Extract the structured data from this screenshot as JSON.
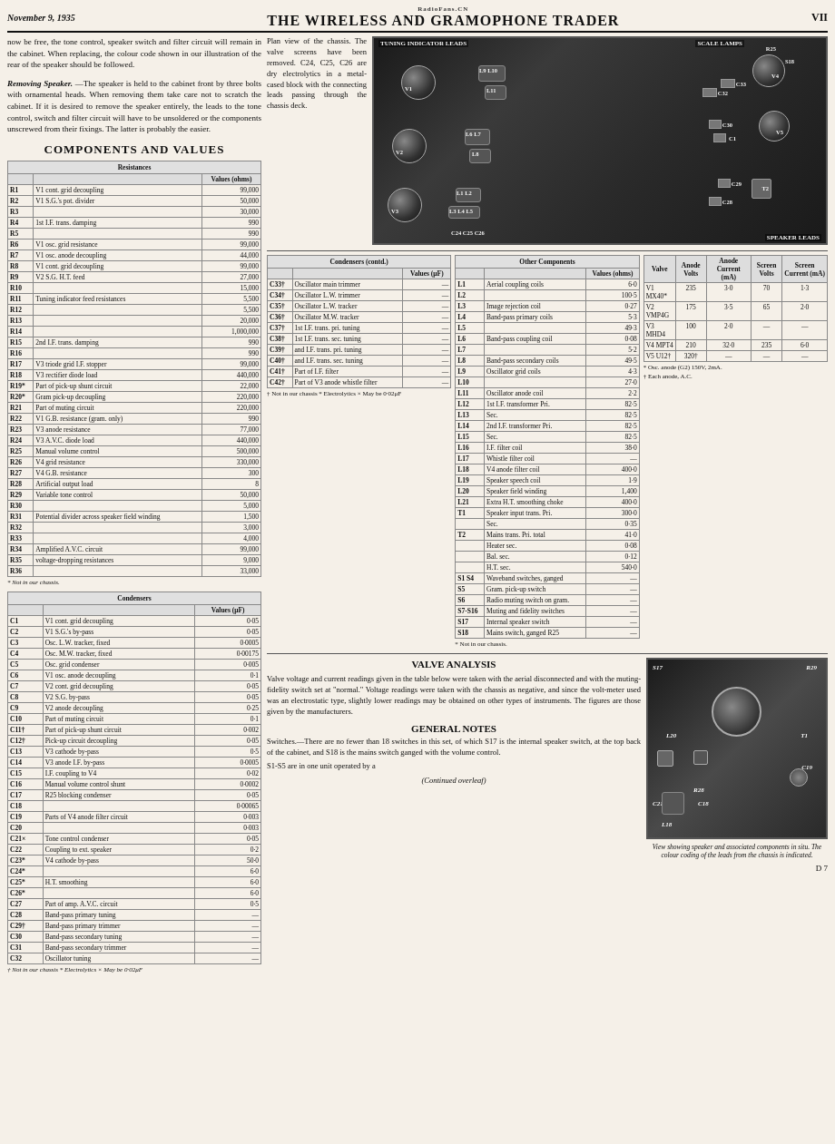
{
  "header": {
    "date": "November 9, 1935",
    "title": "THE WIRELESS AND GRAMOPHONE TRADER",
    "radiofans": "RadioFans.CN",
    "page": "VII"
  },
  "intro": {
    "paragraph1": "now be free, the tone control, speaker switch and filter circuit will remain in the cabinet. When replacing, the colour code shown in our illustration of the rear of the speaker should be followed.",
    "removing_heading": "Removing Speaker.",
    "paragraph2": "—The speaker is held to the cabinet front by three bolts with ornamental heads. When removing them take care not to scratch the cabinet. If it is desired to remove the speaker entirely, the leads to the tone control, switch and filter circuit will have to be unsoldered or the components unscrewed from their fixings. The latter is probably the easier."
  },
  "components_title": "COMPONENTS AND VALUES",
  "chassis_desc": {
    "text1": "Plan view of the chassis. The valve screens have been removed. C24, C25, C26 are dry electrolytics in a metal-cased block with the connecting leads passing through the chassis deck."
  },
  "chassis_labels": {
    "tuning_indicator": "TUNING INDICATOR LEADS",
    "scale_lamps": "SCALE LAMPS",
    "speaker_leads": "SPEAKER LEADS",
    "v1": "V1",
    "v2": "V2",
    "v3": "V3",
    "v4": "V4",
    "v5": "V5",
    "r25": "R25",
    "s18": "S18",
    "c24": "C24",
    "c25": "C25",
    "c26": "C26",
    "c28": "C28",
    "c29": "C29",
    "c30": "C30",
    "c32": "C32",
    "c33": "C33",
    "l9l10": "L9 L10",
    "l11": "L11",
    "l6l7": "L6 L7",
    "l8": "L8",
    "l1l2": "L1 L2",
    "l3l4l5": "L3 L4 L5",
    "t2": "T2"
  },
  "resistances": {
    "title": "Resistances",
    "values_header": "Values (ohms)",
    "rows": [
      {
        "ref": "R1",
        "desc": "V1 cont. grid decoupling",
        "val": "99,000"
      },
      {
        "ref": "R2",
        "desc": "V1 S.G.'s pot. divider",
        "val": "50,000"
      },
      {
        "ref": "R3",
        "desc": "",
        "val": "30,000"
      },
      {
        "ref": "R4",
        "desc": "1st I.F. trans. damping",
        "val": "990"
      },
      {
        "ref": "R5",
        "desc": "",
        "val": "990"
      },
      {
        "ref": "R6",
        "desc": "V1 osc. grid resistance",
        "val": "99,000"
      },
      {
        "ref": "R7",
        "desc": "V1 osc. anode decoupling",
        "val": "44,000"
      },
      {
        "ref": "R8",
        "desc": "V1 cont. grid decoupling",
        "val": "99,000"
      },
      {
        "ref": "R9",
        "desc": "V2 S.G. H.T. feed",
        "val": "27,000"
      },
      {
        "ref": "R10",
        "desc": "",
        "val": "15,000"
      },
      {
        "ref": "R11",
        "desc": "Tuning indicator feed resistances",
        "val": "5,500"
      },
      {
        "ref": "R12",
        "desc": "",
        "val": "5,500"
      },
      {
        "ref": "R13",
        "desc": "",
        "val": "20,000"
      },
      {
        "ref": "R14",
        "desc": "",
        "val": "1,000,000"
      },
      {
        "ref": "R15",
        "desc": "2nd I.F. trans. damping",
        "val": "990"
      },
      {
        "ref": "R16",
        "desc": "",
        "val": "990"
      },
      {
        "ref": "R17",
        "desc": "V3 triode grid I.F. stopper",
        "val": "99,000"
      },
      {
        "ref": "R18",
        "desc": "V3 rectifier diode load",
        "val": "440,000"
      },
      {
        "ref": "R19*",
        "desc": "Part of pick-up shunt circuit",
        "val": "22,000"
      },
      {
        "ref": "R20*",
        "desc": "Gram pick-up decoupling",
        "val": "220,000"
      },
      {
        "ref": "R21",
        "desc": "Part of muting circuit",
        "val": "220,000"
      },
      {
        "ref": "R22",
        "desc": "V1 G.B. resistance (gram. only)",
        "val": "990"
      },
      {
        "ref": "R23",
        "desc": "V3 anode resistance",
        "val": "77,000"
      },
      {
        "ref": "R24",
        "desc": "V3 A.V.C. diode load",
        "val": "440,000"
      },
      {
        "ref": "R25",
        "desc": "Manual volume control",
        "val": "500,000"
      },
      {
        "ref": "R26",
        "desc": "V4 grid resistance",
        "val": "330,000"
      },
      {
        "ref": "R27",
        "desc": "V4 G.B. resistance",
        "val": "300"
      },
      {
        "ref": "R28",
        "desc": "Artificial output load",
        "val": "8"
      },
      {
        "ref": "R29",
        "desc": "Variable tone control",
        "val": "50,000"
      },
      {
        "ref": "R30",
        "desc": "",
        "val": "5,000"
      },
      {
        "ref": "R31",
        "desc": "Potential divider across speaker field winding",
        "val": "1,500"
      },
      {
        "ref": "R32",
        "desc": "",
        "val": "3,000"
      },
      {
        "ref": "R33",
        "desc": "",
        "val": "4,000"
      },
      {
        "ref": "R34",
        "desc": "Amplified A.V.C. circuit",
        "val": "99,000"
      },
      {
        "ref": "R35",
        "desc": "voltage-dropping resistances",
        "val": "9,000"
      },
      {
        "ref": "R36",
        "desc": "",
        "val": "33,000"
      }
    ],
    "footnote": "* Not in our chassis."
  },
  "condensers": {
    "title": "Condensers",
    "values_header": "Values (μF)",
    "rows": [
      {
        "ref": "C1",
        "desc": "V1 cont. grid decoupling",
        "val": "0·05"
      },
      {
        "ref": "C2",
        "desc": "V1 S.G.'s by-pass",
        "val": "0·05"
      },
      {
        "ref": "C3",
        "desc": "Osc. L.W. tracker, fixed",
        "val": "0·0005"
      },
      {
        "ref": "C4",
        "desc": "Osc. M.W. tracker, fixed",
        "val": "0·00175"
      },
      {
        "ref": "C5",
        "desc": "Osc. grid condenser",
        "val": "0·005"
      },
      {
        "ref": "C6",
        "desc": "V1 osc. anode decoupling",
        "val": "0·1"
      },
      {
        "ref": "C7",
        "desc": "V2 cont. grid decoupling",
        "val": "0·05"
      },
      {
        "ref": "C8",
        "desc": "V2 S.G. by-pass",
        "val": "0·05"
      },
      {
        "ref": "C9",
        "desc": "V2 anode decoupling",
        "val": "0·25"
      },
      {
        "ref": "C10",
        "desc": "Part of muting circuit",
        "val": "0·1"
      },
      {
        "ref": "C11†",
        "desc": "Part of pick-up shunt circuit",
        "val": "0·002"
      },
      {
        "ref": "C12†",
        "desc": "Pick-up circuit decoupling",
        "val": "0·05"
      },
      {
        "ref": "C13",
        "desc": "V3 cathode by-pass",
        "val": "0·5"
      },
      {
        "ref": "C14",
        "desc": "V3 anode I.F. by-pass",
        "val": "0·0005"
      },
      {
        "ref": "C15",
        "desc": "I.F. coupling to V4",
        "val": "0·02"
      },
      {
        "ref": "C16",
        "desc": "Manual volume control shunt",
        "val": "0·0002"
      },
      {
        "ref": "C17",
        "desc": "R25 blocking condenser",
        "val": "0·05"
      },
      {
        "ref": "C18",
        "desc": "",
        "val": "0·00065"
      },
      {
        "ref": "C19",
        "desc": "Parts of V4 anode filter circuit",
        "val": "0·003"
      },
      {
        "ref": "C20",
        "desc": "",
        "val": "0·003"
      },
      {
        "ref": "C21×",
        "desc": "Tone control condenser",
        "val": "0·05"
      },
      {
        "ref": "C22",
        "desc": "Coupling to ext. speaker",
        "val": "0·2"
      },
      {
        "ref": "C23*",
        "desc": "V4 cathode by-pass",
        "val": "50·0"
      },
      {
        "ref": "C24*",
        "desc": "",
        "val": "6·0"
      },
      {
        "ref": "C25*",
        "desc": "H.T. smoothing",
        "val": "6·0"
      },
      {
        "ref": "C26*",
        "desc": "",
        "val": "6·0"
      },
      {
        "ref": "C27",
        "desc": "Part of amp. A.V.C. circuit",
        "val": "0·5"
      },
      {
        "ref": "C28",
        "desc": "Band-pass primary tuning",
        "val": "—"
      },
      {
        "ref": "C29†",
        "desc": "Band-pass primary trimmer",
        "val": "—"
      },
      {
        "ref": "C30",
        "desc": "Band-pass secondary tuning",
        "val": "—"
      },
      {
        "ref": "C31",
        "desc": "Band-pass secondary trimmer",
        "val": "—"
      },
      {
        "ref": "C32",
        "desc": "Oscillator tuning",
        "val": "—"
      }
    ],
    "footnote": "† Not in our chassis  * Electrolytics  × May be 0·02μF"
  },
  "condensers_contd": {
    "title": "Condensers (contd.)",
    "values_header": "Values (μF)",
    "rows": [
      {
        "ref": "C33†",
        "desc": "Oscillator main trimmer",
        "val": "—"
      },
      {
        "ref": "C34†",
        "desc": "Oscillator L.W. trimmer",
        "val": "—"
      },
      {
        "ref": "C35†",
        "desc": "Oscillator L.W. tracker",
        "val": "—"
      },
      {
        "ref": "C36†",
        "desc": "Oscillator M.W. tracker",
        "val": "—"
      },
      {
        "ref": "C37†",
        "desc": "1st I.F. trans. pri. tuning",
        "val": "—"
      },
      {
        "ref": "C38†",
        "desc": "1st I.F. trans. sec. tuning",
        "val": "—"
      },
      {
        "ref": "C39†",
        "desc": "and I.F. trans. pri. tuning",
        "val": "—"
      },
      {
        "ref": "C40†",
        "desc": "and I.F. trans. sec. tuning",
        "val": "—"
      },
      {
        "ref": "C41†",
        "desc": "Part of I.F. filter",
        "val": "—"
      },
      {
        "ref": "C42†",
        "desc": "Part of V3 anode whistle filter",
        "val": "—"
      }
    ],
    "footnote": "† Not in our chassis  * Electrolytics  × May be 0·02μF"
  },
  "other_components": {
    "title": "Other Components",
    "values_header": "Values (ohms)",
    "rows": [
      {
        "ref": "L1",
        "desc": "Aerial coupling coils",
        "val": "6·0"
      },
      {
        "ref": "L2",
        "desc": "",
        "val": "100·5"
      },
      {
        "ref": "L3",
        "desc": "Image rejection coil",
        "val": "0·27"
      },
      {
        "ref": "L4",
        "desc": "Band-pass primary coils",
        "val": "5·3"
      },
      {
        "ref": "L5",
        "desc": "",
        "val": "49·3"
      },
      {
        "ref": "L6",
        "desc": "Band-pass coupling coil",
        "val": "0·08"
      },
      {
        "ref": "L7",
        "desc": "",
        "val": "5·2"
      },
      {
        "ref": "L8",
        "desc": "Band-pass secondary coils",
        "val": "49·5"
      },
      {
        "ref": "L9",
        "desc": "Oscillator grid coils",
        "val": "4·3"
      },
      {
        "ref": "L10",
        "desc": "",
        "val": "27·0"
      },
      {
        "ref": "L11",
        "desc": "Oscillator anode coil",
        "val": "2·2"
      },
      {
        "ref": "L12",
        "desc": "1st I.F. transformer Pri.",
        "val": "82·5"
      },
      {
        "ref": "L13",
        "desc": "Sec.",
        "val": "82·5"
      },
      {
        "ref": "L14",
        "desc": "2nd I.F. transformer Pri.",
        "val": "82·5"
      },
      {
        "ref": "L15",
        "desc": "Sec.",
        "val": "82·5"
      },
      {
        "ref": "L16",
        "desc": "I.F. filter coil",
        "val": "38·0"
      },
      {
        "ref": "L17",
        "desc": "Whistle filter coil",
        "val": "—"
      },
      {
        "ref": "L18",
        "desc": "V4 anode filter coil",
        "val": "400·0"
      },
      {
        "ref": "L19",
        "desc": "Speaker speech coil",
        "val": "1·9"
      },
      {
        "ref": "L20",
        "desc": "Speaker field winding",
        "val": "1,400"
      },
      {
        "ref": "L21",
        "desc": "Extra H.T. smoothing choke",
        "val": "400·0"
      },
      {
        "ref": "T1",
        "desc": "Speaker input trans. Pri.",
        "val": "300·0"
      },
      {
        "ref": "",
        "desc": "Sec.",
        "val": "0·35"
      },
      {
        "ref": "T2",
        "desc": "Mains trans. Pri. total",
        "val": "41·0"
      },
      {
        "ref": "",
        "desc": "Heater sec.",
        "val": "0·08"
      },
      {
        "ref": "",
        "desc": "Bal. sec.",
        "val": "0·12"
      },
      {
        "ref": "",
        "desc": "H.T. sec.",
        "val": "540·0"
      },
      {
        "ref": "S1 S4",
        "desc": "Waveband switches, ganged",
        "val": "—"
      },
      {
        "ref": "S5",
        "desc": "Gram. pick-up switch",
        "val": "—"
      },
      {
        "ref": "S6",
        "desc": "Radio muting switch on gram.",
        "val": "—"
      },
      {
        "ref": "S7-S16",
        "desc": "Muting and fidelity switches",
        "val": "—"
      },
      {
        "ref": "S17",
        "desc": "Internal speaker switch",
        "val": "—"
      },
      {
        "ref": "S18",
        "desc": "Mains switch, ganged R25",
        "val": "—"
      }
    ],
    "footnote": "* Not in our chassis."
  },
  "valve_analysis": {
    "title": "VALVE ANALYSIS",
    "text": "Valve voltage and current readings given in the table below were taken with the aerial disconnected and with the muting-fidelity switch set at \"normal.\" Voltage readings were taken with the chassis as negative, and since the volt-meter used was an electrostatic type, slightly lower readings may be obtained on other types of instruments. The figures are those given by the manufacturers.",
    "table_headers": [
      "Valve",
      "Anode Volts",
      "Anode Current (mA)",
      "Screen Volts",
      "Screen Current (mA)"
    ],
    "rows": [
      {
        "valve": "V1 MX40*",
        "anode_v": "235",
        "anode_ma": "3·0",
        "screen_v": "70",
        "screen_ma": "1·3"
      },
      {
        "valve": "V2 VMP4G",
        "anode_v": "175",
        "anode_ma": "3·5",
        "screen_v": "65",
        "screen_ma": "2·0"
      },
      {
        "valve": "V3 MHD4",
        "anode_v": "100",
        "anode_ma": "2·0",
        "screen_v": "—",
        "screen_ma": "—"
      },
      {
        "valve": "V4 MPT4",
        "anode_v": "210",
        "anode_ma": "32·0",
        "screen_v": "235",
        "screen_ma": "6·0"
      },
      {
        "valve": "V5 U12†",
        "anode_v": "320†",
        "anode_ma": "—",
        "screen_v": "—",
        "screen_ma": "—"
      }
    ],
    "footnote1": "* Osc. anode (G2) 150V, 2mA.",
    "footnote2": "† Each anode, A.C."
  },
  "general_notes": {
    "title": "GENERAL NOTES",
    "text1": "Switches.—There are no fewer than 18 switches in this set, of which S17 is the internal speaker switch, at the top back of the cabinet, and S18 is the mains switch ganged with the volume control.",
    "text2": "S1-S5 are in one unit operated by a",
    "continued": "(Continued overleaf)"
  },
  "speaker_image_caption": "View showing speaker and associated components in situ. The colour coding of the leads from the chassis is indicated.",
  "speaker_labels": {
    "s17": "S17",
    "r29": "R29",
    "l20": "L20",
    "t1": "T1",
    "r28": "R28",
    "c21": "C21",
    "c18": "C18",
    "l18": "L18",
    "c19": "C19"
  },
  "page_num_bottom": "D 7"
}
